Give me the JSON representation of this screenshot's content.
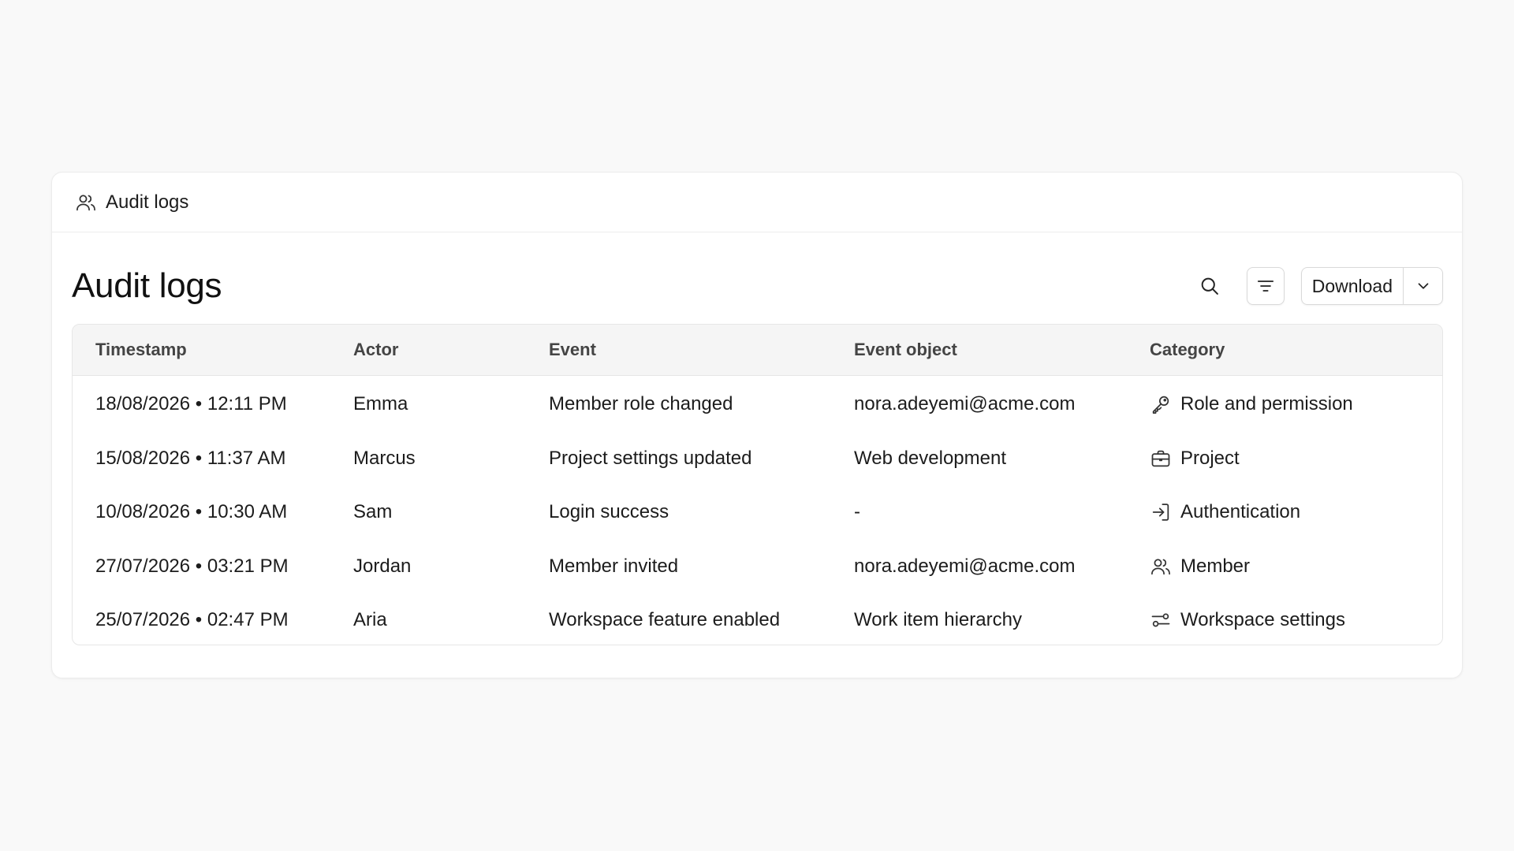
{
  "header": {
    "title": "Audit logs",
    "icon": "users-icon"
  },
  "page": {
    "title": "Audit logs"
  },
  "toolbar": {
    "search_icon": "search-icon",
    "filter_icon": "filter-icon",
    "download_label": "Download",
    "download_caret_icon": "chevron-down-icon"
  },
  "table": {
    "columns": [
      "Timestamp",
      "Actor",
      "Event",
      "Event object",
      "Category"
    ],
    "rows": [
      {
        "timestamp": "18/08/2026 • 12:11 PM",
        "actor": "Emma",
        "event": "Member role changed",
        "object": "nora.adeyemi@acme.com",
        "category": "Role and permission",
        "category_icon": "key-icon"
      },
      {
        "timestamp": "15/08/2026 • 11:37 AM",
        "actor": "Marcus",
        "event": "Project settings updated",
        "object": "Web development",
        "category": "Project",
        "category_icon": "briefcase-icon"
      },
      {
        "timestamp": "10/08/2026 • 10:30 AM",
        "actor": "Sam",
        "event": "Login success",
        "object": "-",
        "category": "Authentication",
        "category_icon": "login-icon"
      },
      {
        "timestamp": "27/07/2026 • 03:21 PM",
        "actor": "Jordan",
        "event": "Member invited",
        "object": "nora.adeyemi@acme.com",
        "category": "Member",
        "category_icon": "users-icon"
      },
      {
        "timestamp": "25/07/2026 • 02:47 PM",
        "actor": "Aria",
        "event": "Workspace feature enabled",
        "object": "Work item hierarchy",
        "category": "Workspace settings",
        "category_icon": "settings-sliders-icon"
      }
    ]
  }
}
